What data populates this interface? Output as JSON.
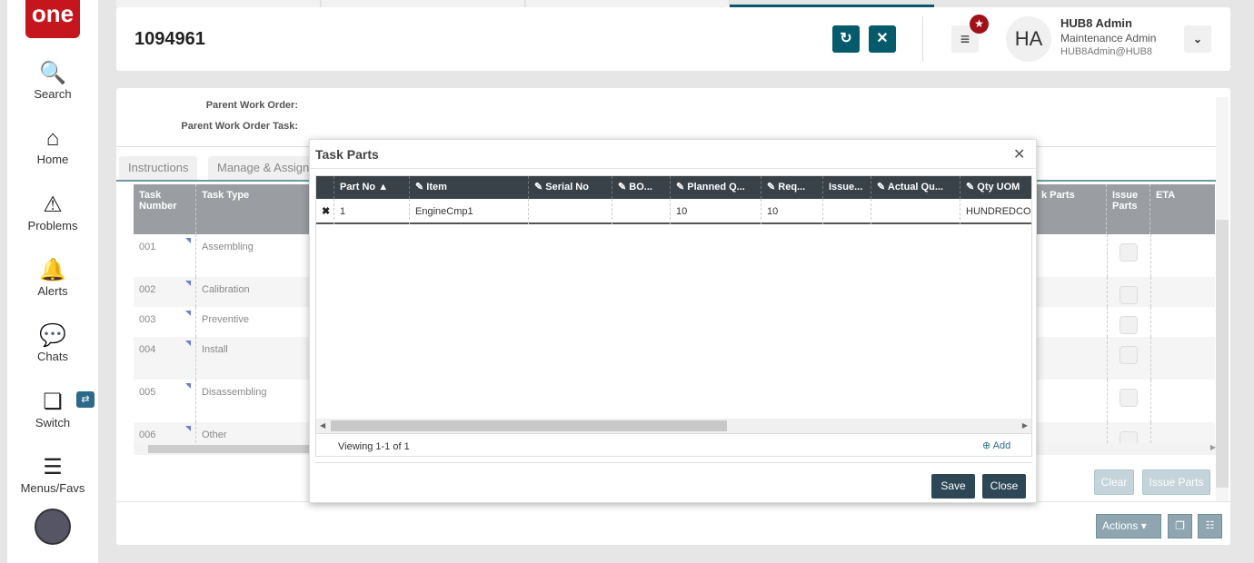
{
  "sidebar": {
    "logo": "one",
    "items": [
      {
        "label": "Search",
        "icon": "search-icon"
      },
      {
        "label": "Home",
        "icon": "home-icon"
      },
      {
        "label": "Problems",
        "icon": "warning-icon"
      },
      {
        "label": "Alerts",
        "icon": "bell-icon"
      },
      {
        "label": "Chats",
        "icon": "chat-icon"
      },
      {
        "label": "Switch",
        "icon": "switch-icon"
      },
      {
        "label": "Menus/Favs",
        "icon": "menu-icon"
      }
    ]
  },
  "header": {
    "title": "1094961",
    "user": {
      "initials": "HA",
      "name": "HUB8 Admin",
      "role": "Maintenance Admin",
      "email": "HUB8Admin@HUB8"
    }
  },
  "main": {
    "fields": {
      "parent_wo": "Parent Work Order:",
      "parent_wo_task": "Parent Work Order Task:"
    },
    "tabs": [
      "Instructions",
      "Manage & Assign"
    ],
    "columns": {
      "task_number": "Task Number",
      "task_type": "Task Type",
      "task_parts": "k Parts",
      "issue_parts": "Issue Parts",
      "eta": "ETA"
    },
    "rows": [
      {
        "num": "001",
        "type": "Assembling"
      },
      {
        "num": "002",
        "type": "Calibration"
      },
      {
        "num": "003",
        "type": "Preventive"
      },
      {
        "num": "004",
        "type": "Install"
      },
      {
        "num": "005",
        "type": "Disassembling"
      },
      {
        "num": "006",
        "type": "Other"
      }
    ],
    "clear": "Clear",
    "issue_parts": "Issue Parts",
    "actions": "Actions"
  },
  "modal": {
    "title": "Task Parts",
    "columns": [
      "Part No",
      "Item",
      "Serial No",
      "BO...",
      "Planned Q...",
      "Req...",
      "Issue...",
      "Actual Qu...",
      "Qty UOM"
    ],
    "rows": [
      [
        "1",
        "EngineCmp1",
        "",
        "",
        "10",
        "10",
        "",
        "",
        "HUNDREDCOUNT"
      ]
    ],
    "viewing": "Viewing 1-1 of 1",
    "add": "Add",
    "save": "Save",
    "close": "Close"
  }
}
